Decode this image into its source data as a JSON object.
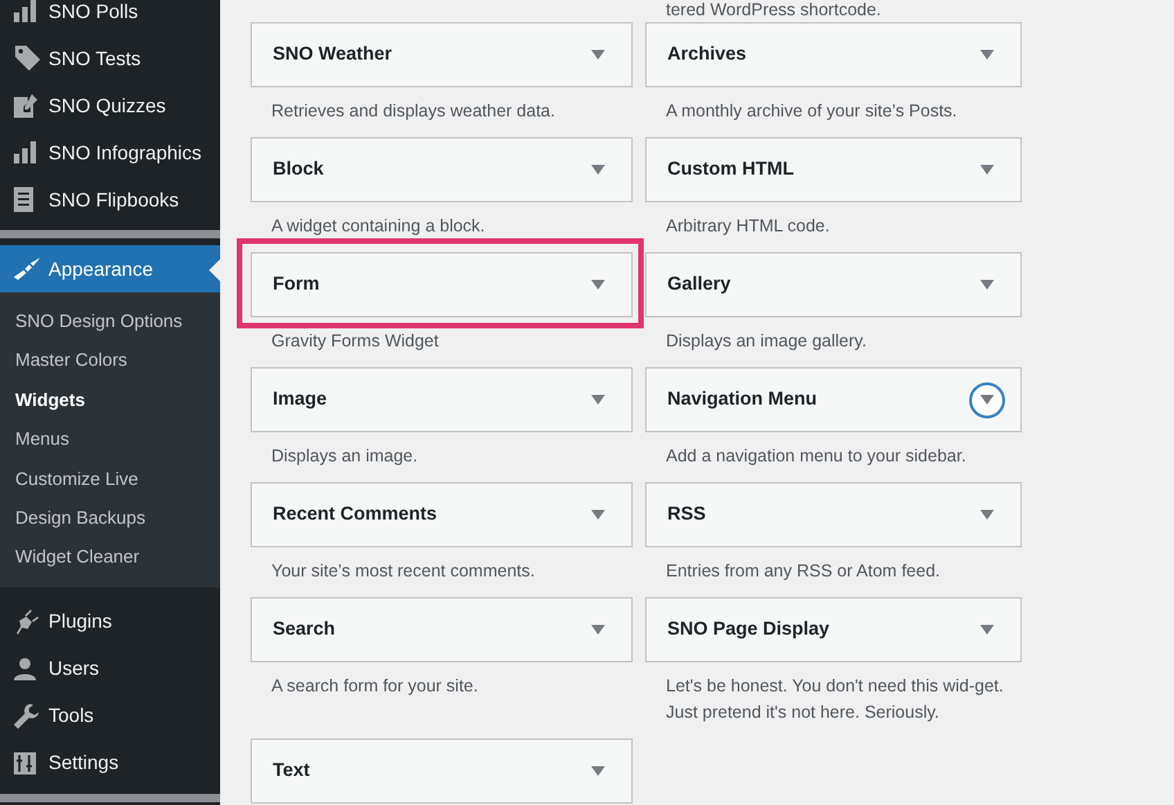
{
  "sidebar": {
    "items": [
      {
        "kind": "menu",
        "label": "SNO Polls",
        "selected": false
      },
      {
        "kind": "menu",
        "label": "SNO Tests",
        "selected": false
      },
      {
        "kind": "menu",
        "label": "SNO Quizzes",
        "selected": false
      },
      {
        "kind": "menu",
        "label": "SNO Infographics",
        "selected": false
      },
      {
        "kind": "menu",
        "label": "SNO Flipbooks",
        "selected": false
      },
      {
        "kind": "separator"
      },
      {
        "kind": "menu",
        "label": "Appearance",
        "selected": true,
        "children": [
          {
            "label": "SNO Design Options",
            "selected": false
          },
          {
            "label": "Master Colors",
            "selected": false
          },
          {
            "label": "Widgets",
            "selected": true
          },
          {
            "label": "Menus",
            "selected": false
          },
          {
            "label": "Customize Live",
            "selected": false
          },
          {
            "label": "Design Backups",
            "selected": false
          },
          {
            "label": "Widget Cleaner",
            "selected": false
          }
        ]
      },
      {
        "kind": "menu",
        "label": "Plugins",
        "selected": false
      },
      {
        "kind": "menu",
        "label": "Users",
        "selected": false
      },
      {
        "kind": "menu",
        "label": "Tools",
        "selected": false
      },
      {
        "kind": "menu",
        "label": "Settings",
        "selected": false
      },
      {
        "kind": "separator"
      }
    ]
  },
  "widgets": {
    "top_description": "tered WordPress shortcode.",
    "items": [
      {
        "title": "SNO Weather",
        "description": "Retrieves and displays weather data.",
        "highlighted": false,
        "focused": false
      },
      {
        "title": "Archives",
        "description": "A monthly archive of your site’s Posts.",
        "highlighted": false,
        "focused": false
      },
      {
        "title": "Block",
        "description": "A widget containing a block.",
        "highlighted": false,
        "focused": false
      },
      {
        "title": "Custom HTML",
        "description": "Arbitrary HTML code.",
        "highlighted": false,
        "focused": false
      },
      {
        "title": "Form",
        "description": "Gravity Forms Widget",
        "highlighted": true,
        "focused": false
      },
      {
        "title": "Gallery",
        "description": "Displays an image gallery.",
        "highlighted": false,
        "focused": false
      },
      {
        "title": "Image",
        "description": "Displays an image.",
        "highlighted": false,
        "focused": false
      },
      {
        "title": "Navigation Menu",
        "description": "Add a navigation menu to your sidebar.",
        "highlighted": false,
        "focused": true
      },
      {
        "title": "Recent Comments",
        "description": "Your site’s most recent comments.",
        "highlighted": false,
        "focused": false
      },
      {
        "title": "RSS",
        "description": "Entries from any RSS or Atom feed.",
        "highlighted": false,
        "focused": false
      },
      {
        "title": "Search",
        "description": "A search form for your site.",
        "highlighted": false,
        "focused": false
      },
      {
        "title": "SNO Page Display",
        "description": "Let's be honest. You don't need this wid-get. Just pretend it's not here. Seriously.",
        "highlighted": false,
        "focused": false
      },
      {
        "title": "Text",
        "highlighted": false,
        "focused": false
      }
    ]
  }
}
